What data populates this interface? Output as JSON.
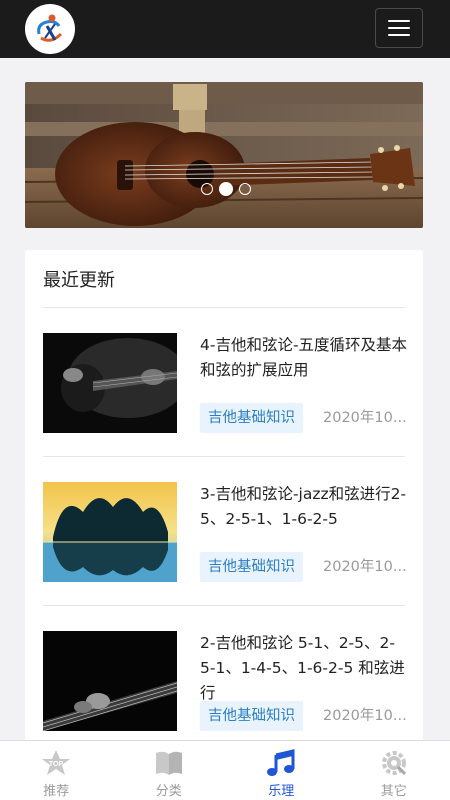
{
  "header": {
    "menu_icon": "hamburger-menu-icon",
    "logo_icon": "guitar-logo-icon"
  },
  "banner": {
    "slide_count": 3,
    "active_slide": 2
  },
  "latest": {
    "title": "最近更新",
    "items": [
      {
        "title": "4-吉他和弦论-五度循环及基本和弦的扩展应用",
        "tag": "吉他基础知识",
        "date": "2020年10..."
      },
      {
        "title": "3-吉他和弦论-jazz和弦进行2-5、2-5-1、1-6-2-5",
        "tag": "吉他基础知识",
        "date": "2020年10..."
      },
      {
        "title": "2-吉他和弦论 5-1、2-5、2-5-1、1-4-5、1-6-2-5 和弦进行",
        "tag": "吉他基础知识",
        "date": "2020年10..."
      }
    ]
  },
  "nav": {
    "items": [
      {
        "label": "推荐",
        "icon": "top-star-icon",
        "active": false
      },
      {
        "label": "分类",
        "icon": "book-icon",
        "active": false
      },
      {
        "label": "乐理",
        "icon": "music-note-icon",
        "active": true
      },
      {
        "label": "其它",
        "icon": "gear-icon",
        "active": false
      }
    ],
    "active_color": "#1f56d6",
    "inactive_color": "#9a9a9a"
  }
}
